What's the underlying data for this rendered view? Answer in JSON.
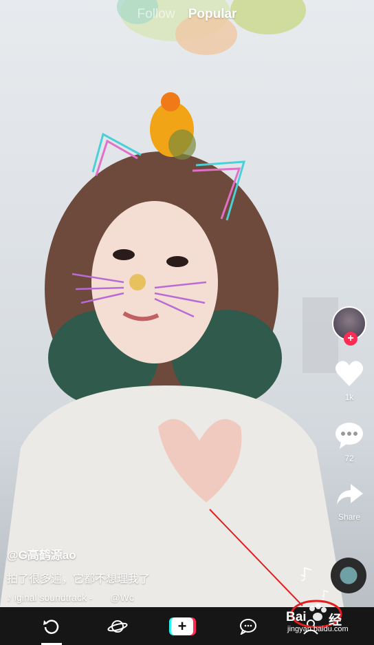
{
  "top_tabs": {
    "follow": "Follow",
    "popular": "Popular"
  },
  "right_rail": {
    "likes_count": "1k",
    "comments_count": "72",
    "share_label": "Share",
    "follow_badge": "+"
  },
  "caption": {
    "username": "@G高鹤源ao",
    "description": "拍了很多遍，它都不想理我了",
    "music_note": "♪",
    "sound_title": "iginal soundtrack -",
    "sound_author": "@Wc"
  },
  "bottom_nav": {
    "create_symbol": "+",
    "active_tab": "refresh"
  },
  "watermark": {
    "text_bai": "Bai",
    "text_jing": "经",
    "url": "jingyan.baidu.com"
  },
  "colors": {
    "accent_red": "#fe2c55",
    "accent_cyan": "#25f4ee",
    "annotation_red": "#e02020"
  }
}
